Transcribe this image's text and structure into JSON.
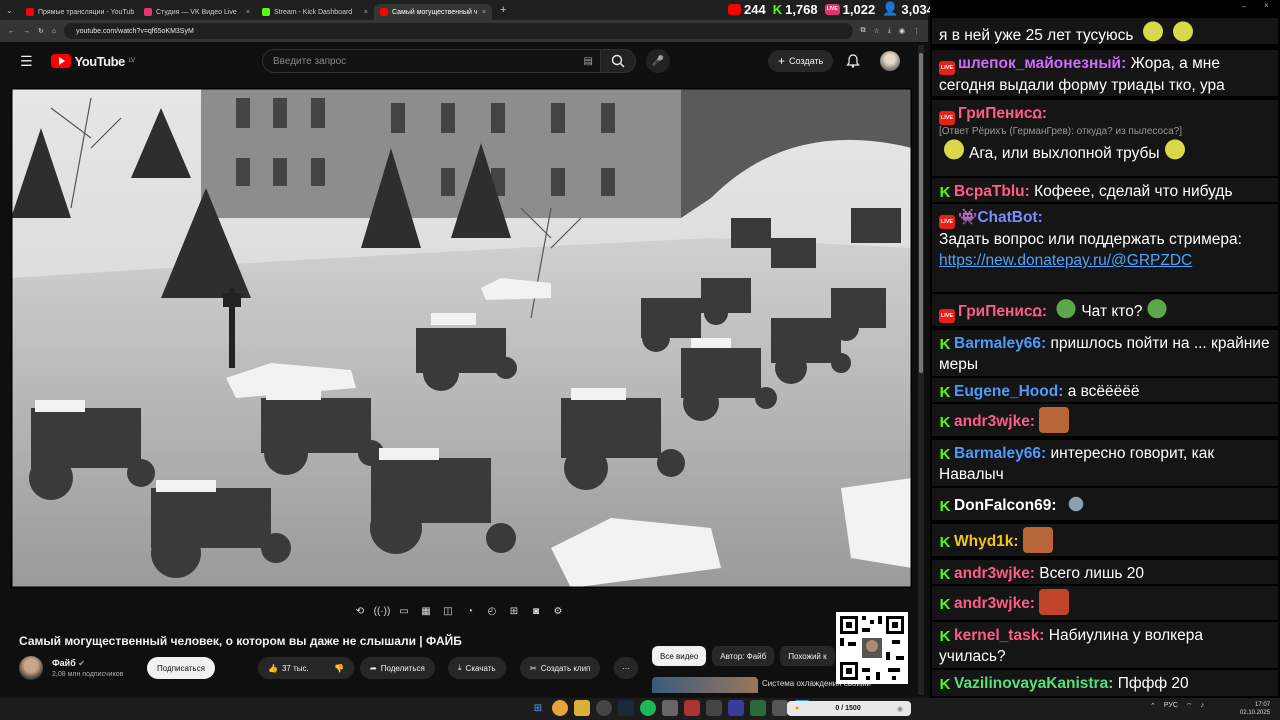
{
  "browser": {
    "tabs": [
      {
        "title": "Прямые трансляции - YouTub",
        "color": "#ff0000"
      },
      {
        "title": "Студия — VK Видео Live",
        "color": "#e8336e"
      },
      {
        "title": "Stream - Kick Dashboard",
        "color": "#53fc18"
      },
      {
        "title": "Самый могущественный ч",
        "color": "#ff0000"
      }
    ],
    "url": "youtube.com/watch?v=qf65oKM3SyM"
  },
  "youtube": {
    "logo_text": "YouTube",
    "logo_region": "LV",
    "search_placeholder": "Введите запрос",
    "create_label": "Создать",
    "video_title": "Самый могущественный человек, о котором вы даже не слышали | ФАЙБ",
    "channel_name": "Файб",
    "subscribers": "2,08 млн подписчиков",
    "subscribe_label": "Подписаться",
    "likes": "37 тыс.",
    "share_label": "Поделиться",
    "download_label": "Скачать",
    "clip_label": "Создать клип",
    "more_label": "···",
    "chips": [
      "Все видео",
      "Автор: Файб",
      "Похожий к"
    ],
    "rec_title": "Система охлаждения своими"
  },
  "counters": {
    "youtube": "244",
    "kick": "1,768",
    "vk": "1,022",
    "viewers": "3,034"
  },
  "chat": {
    "messages": [
      {
        "platform": "none",
        "name": "",
        "name_color": "#ffffff",
        "text": "я в ней уже 25 лет тусуюсь",
        "emote": "pepe"
      },
      {
        "platform": "yt",
        "name": "шлепок_майонезный:",
        "name_color": "#cf6bff",
        "text": "Жора, а мне сегодня выдали форму триады тко, ура",
        "emote": ""
      },
      {
        "platform": "yt",
        "name": "ГриПенисꭥ:",
        "name_color": "#ff5c8a",
        "reply": "[Ответ Рёрихъ (ГерманГрев): откуда? из пылесоса?]",
        "text": "Ага, или выхлопной трубы",
        "emote": "pepe"
      },
      {
        "platform": "k",
        "name": "ВсраТblu:",
        "name_color": "#ff5c8a",
        "text": "Кофеее, сделай что нибудь",
        "emote": ""
      },
      {
        "platform": "yt",
        "name": "ChatBot:",
        "name_color": "#7d8cff",
        "text": "Задать вопрос или поддержать стримера:",
        "link": "https://new.donatepay.ru/@GRPZDC",
        "emote": ""
      },
      {
        "platform": "yt",
        "name": "ГриПенисꭥ:",
        "name_color": "#ff5c8a",
        "text": "Чат кто?",
        "emote": "frog"
      },
      {
        "platform": "k",
        "name": "Barmaley66:",
        "name_color": "#4d9bff",
        "text": "пришлось пойти на ... крайние меры",
        "emote": ""
      },
      {
        "platform": "k",
        "name": "Eugene_Hood:",
        "name_color": "#4d9bff",
        "text": "а всёёёёё",
        "emote": ""
      },
      {
        "platform": "k",
        "name": "andr3wjke:",
        "name_color": "#ff5c8a",
        "text": "",
        "emote": "face"
      },
      {
        "platform": "k",
        "name": "Barmaley66:",
        "name_color": "#4d9bff",
        "text": "интересно говорит, как Навалыч",
        "emote": ""
      },
      {
        "platform": "k",
        "name": "DonFalcon69:",
        "name_color": "#ffffff",
        "text": "",
        "emote": "bird"
      },
      {
        "platform": "k",
        "name": "Whyd1k:",
        "name_color": "#f5c518",
        "text": "",
        "emote": "face"
      },
      {
        "platform": "k",
        "name": "andr3wjke:",
        "name_color": "#ff5c8a",
        "text": "Всего лишь 20",
        "emote": ""
      },
      {
        "platform": "k",
        "name": "andr3wjke:",
        "name_color": "#ff5c8a",
        "text": "",
        "emote": "face"
      },
      {
        "platform": "k",
        "name": "kernel_task:",
        "name_color": "#ff5c8a",
        "text": "Набиулина у волкера училась?",
        "emote": ""
      },
      {
        "platform": "k",
        "name": "VazilinovayaKanistra:",
        "name_color": "#55e07a",
        "text": "Пффф 20",
        "emote": ""
      }
    ]
  },
  "taskbar": {
    "widget_left": "0 / 1500",
    "lang": "РУС",
    "time": "17:07",
    "date": "02.10.2025"
  }
}
